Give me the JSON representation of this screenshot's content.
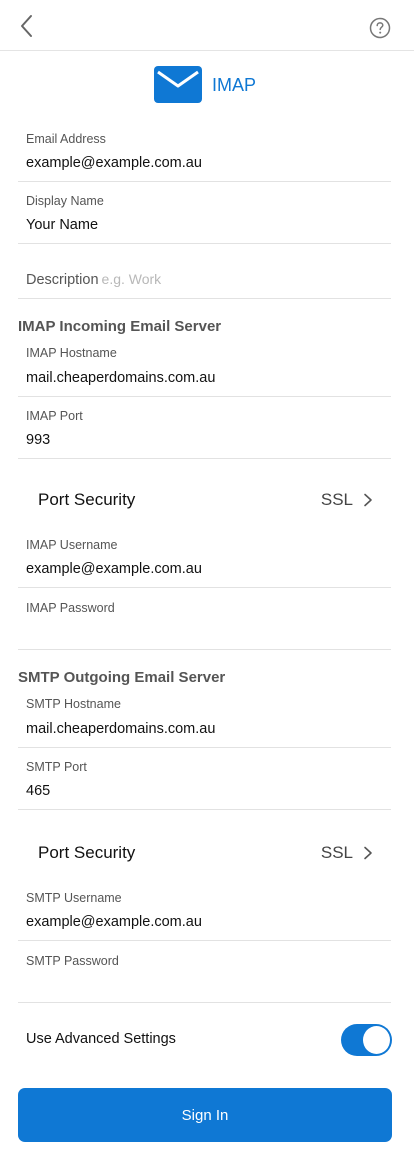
{
  "header": {
    "back_icon": "chevron-left-icon",
    "help_icon": "question-circle-icon"
  },
  "account": {
    "title": "IMAP",
    "logo_icon": "envelope-icon",
    "accent_color": "#0f78d4"
  },
  "fields": {
    "email_address": {
      "label": "Email Address",
      "value": "example@example.com.au"
    },
    "display_name": {
      "label": "Display Name",
      "value": "Your Name"
    },
    "description": {
      "label": "Description",
      "placeholder": "e.g. Work",
      "value": ""
    }
  },
  "incoming": {
    "section_title": "IMAP Incoming Email Server",
    "hostname": {
      "label": "IMAP Hostname",
      "value": "mail.cheaperdomains.com.au"
    },
    "port": {
      "label": "IMAP Port",
      "value": "993"
    },
    "security": {
      "label": "Port Security",
      "value": "SSL"
    },
    "username": {
      "label": "IMAP Username",
      "value": "example@example.com.au"
    },
    "password": {
      "label": "IMAP Password",
      "value": ""
    }
  },
  "outgoing": {
    "section_title": "SMTP Outgoing Email Server",
    "hostname": {
      "label": "SMTP Hostname",
      "value": "mail.cheaperdomains.com.au"
    },
    "port": {
      "label": "SMTP Port",
      "value": "465"
    },
    "security": {
      "label": "Port Security",
      "value": "SSL"
    },
    "username": {
      "label": "SMTP Username",
      "value": "example@example.com.au"
    },
    "password": {
      "label": "SMTP Password",
      "value": ""
    }
  },
  "advanced": {
    "label": "Use Advanced Settings",
    "enabled": true
  },
  "actions": {
    "sign_in": "Sign In"
  }
}
